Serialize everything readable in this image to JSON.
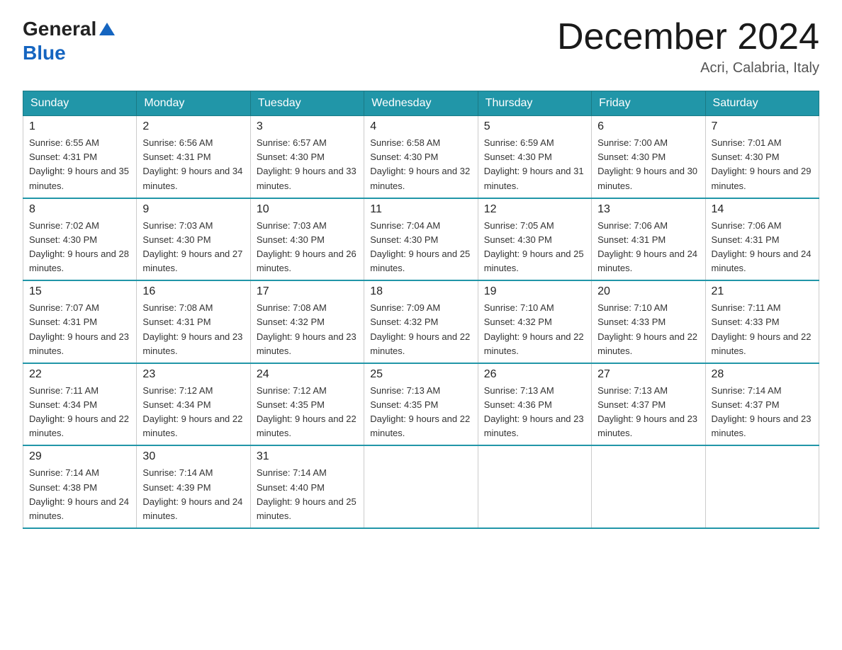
{
  "header": {
    "logo_general": "General",
    "logo_blue": "Blue",
    "month_title": "December 2024",
    "location": "Acri, Calabria, Italy"
  },
  "days_of_week": [
    "Sunday",
    "Monday",
    "Tuesday",
    "Wednesday",
    "Thursday",
    "Friday",
    "Saturday"
  ],
  "weeks": [
    [
      {
        "day": "1",
        "sunrise": "6:55 AM",
        "sunset": "4:31 PM",
        "daylight": "9 hours and 35 minutes."
      },
      {
        "day": "2",
        "sunrise": "6:56 AM",
        "sunset": "4:31 PM",
        "daylight": "9 hours and 34 minutes."
      },
      {
        "day": "3",
        "sunrise": "6:57 AM",
        "sunset": "4:30 PM",
        "daylight": "9 hours and 33 minutes."
      },
      {
        "day": "4",
        "sunrise": "6:58 AM",
        "sunset": "4:30 PM",
        "daylight": "9 hours and 32 minutes."
      },
      {
        "day": "5",
        "sunrise": "6:59 AM",
        "sunset": "4:30 PM",
        "daylight": "9 hours and 31 minutes."
      },
      {
        "day": "6",
        "sunrise": "7:00 AM",
        "sunset": "4:30 PM",
        "daylight": "9 hours and 30 minutes."
      },
      {
        "day": "7",
        "sunrise": "7:01 AM",
        "sunset": "4:30 PM",
        "daylight": "9 hours and 29 minutes."
      }
    ],
    [
      {
        "day": "8",
        "sunrise": "7:02 AM",
        "sunset": "4:30 PM",
        "daylight": "9 hours and 28 minutes."
      },
      {
        "day": "9",
        "sunrise": "7:03 AM",
        "sunset": "4:30 PM",
        "daylight": "9 hours and 27 minutes."
      },
      {
        "day": "10",
        "sunrise": "7:03 AM",
        "sunset": "4:30 PM",
        "daylight": "9 hours and 26 minutes."
      },
      {
        "day": "11",
        "sunrise": "7:04 AM",
        "sunset": "4:30 PM",
        "daylight": "9 hours and 25 minutes."
      },
      {
        "day": "12",
        "sunrise": "7:05 AM",
        "sunset": "4:30 PM",
        "daylight": "9 hours and 25 minutes."
      },
      {
        "day": "13",
        "sunrise": "7:06 AM",
        "sunset": "4:31 PM",
        "daylight": "9 hours and 24 minutes."
      },
      {
        "day": "14",
        "sunrise": "7:06 AM",
        "sunset": "4:31 PM",
        "daylight": "9 hours and 24 minutes."
      }
    ],
    [
      {
        "day": "15",
        "sunrise": "7:07 AM",
        "sunset": "4:31 PM",
        "daylight": "9 hours and 23 minutes."
      },
      {
        "day": "16",
        "sunrise": "7:08 AM",
        "sunset": "4:31 PM",
        "daylight": "9 hours and 23 minutes."
      },
      {
        "day": "17",
        "sunrise": "7:08 AM",
        "sunset": "4:32 PM",
        "daylight": "9 hours and 23 minutes."
      },
      {
        "day": "18",
        "sunrise": "7:09 AM",
        "sunset": "4:32 PM",
        "daylight": "9 hours and 22 minutes."
      },
      {
        "day": "19",
        "sunrise": "7:10 AM",
        "sunset": "4:32 PM",
        "daylight": "9 hours and 22 minutes."
      },
      {
        "day": "20",
        "sunrise": "7:10 AM",
        "sunset": "4:33 PM",
        "daylight": "9 hours and 22 minutes."
      },
      {
        "day": "21",
        "sunrise": "7:11 AM",
        "sunset": "4:33 PM",
        "daylight": "9 hours and 22 minutes."
      }
    ],
    [
      {
        "day": "22",
        "sunrise": "7:11 AM",
        "sunset": "4:34 PM",
        "daylight": "9 hours and 22 minutes."
      },
      {
        "day": "23",
        "sunrise": "7:12 AM",
        "sunset": "4:34 PM",
        "daylight": "9 hours and 22 minutes."
      },
      {
        "day": "24",
        "sunrise": "7:12 AM",
        "sunset": "4:35 PM",
        "daylight": "9 hours and 22 minutes."
      },
      {
        "day": "25",
        "sunrise": "7:13 AM",
        "sunset": "4:35 PM",
        "daylight": "9 hours and 22 minutes."
      },
      {
        "day": "26",
        "sunrise": "7:13 AM",
        "sunset": "4:36 PM",
        "daylight": "9 hours and 23 minutes."
      },
      {
        "day": "27",
        "sunrise": "7:13 AM",
        "sunset": "4:37 PM",
        "daylight": "9 hours and 23 minutes."
      },
      {
        "day": "28",
        "sunrise": "7:14 AM",
        "sunset": "4:37 PM",
        "daylight": "9 hours and 23 minutes."
      }
    ],
    [
      {
        "day": "29",
        "sunrise": "7:14 AM",
        "sunset": "4:38 PM",
        "daylight": "9 hours and 24 minutes."
      },
      {
        "day": "30",
        "sunrise": "7:14 AM",
        "sunset": "4:39 PM",
        "daylight": "9 hours and 24 minutes."
      },
      {
        "day": "31",
        "sunrise": "7:14 AM",
        "sunset": "4:40 PM",
        "daylight": "9 hours and 25 minutes."
      },
      null,
      null,
      null,
      null
    ]
  ]
}
